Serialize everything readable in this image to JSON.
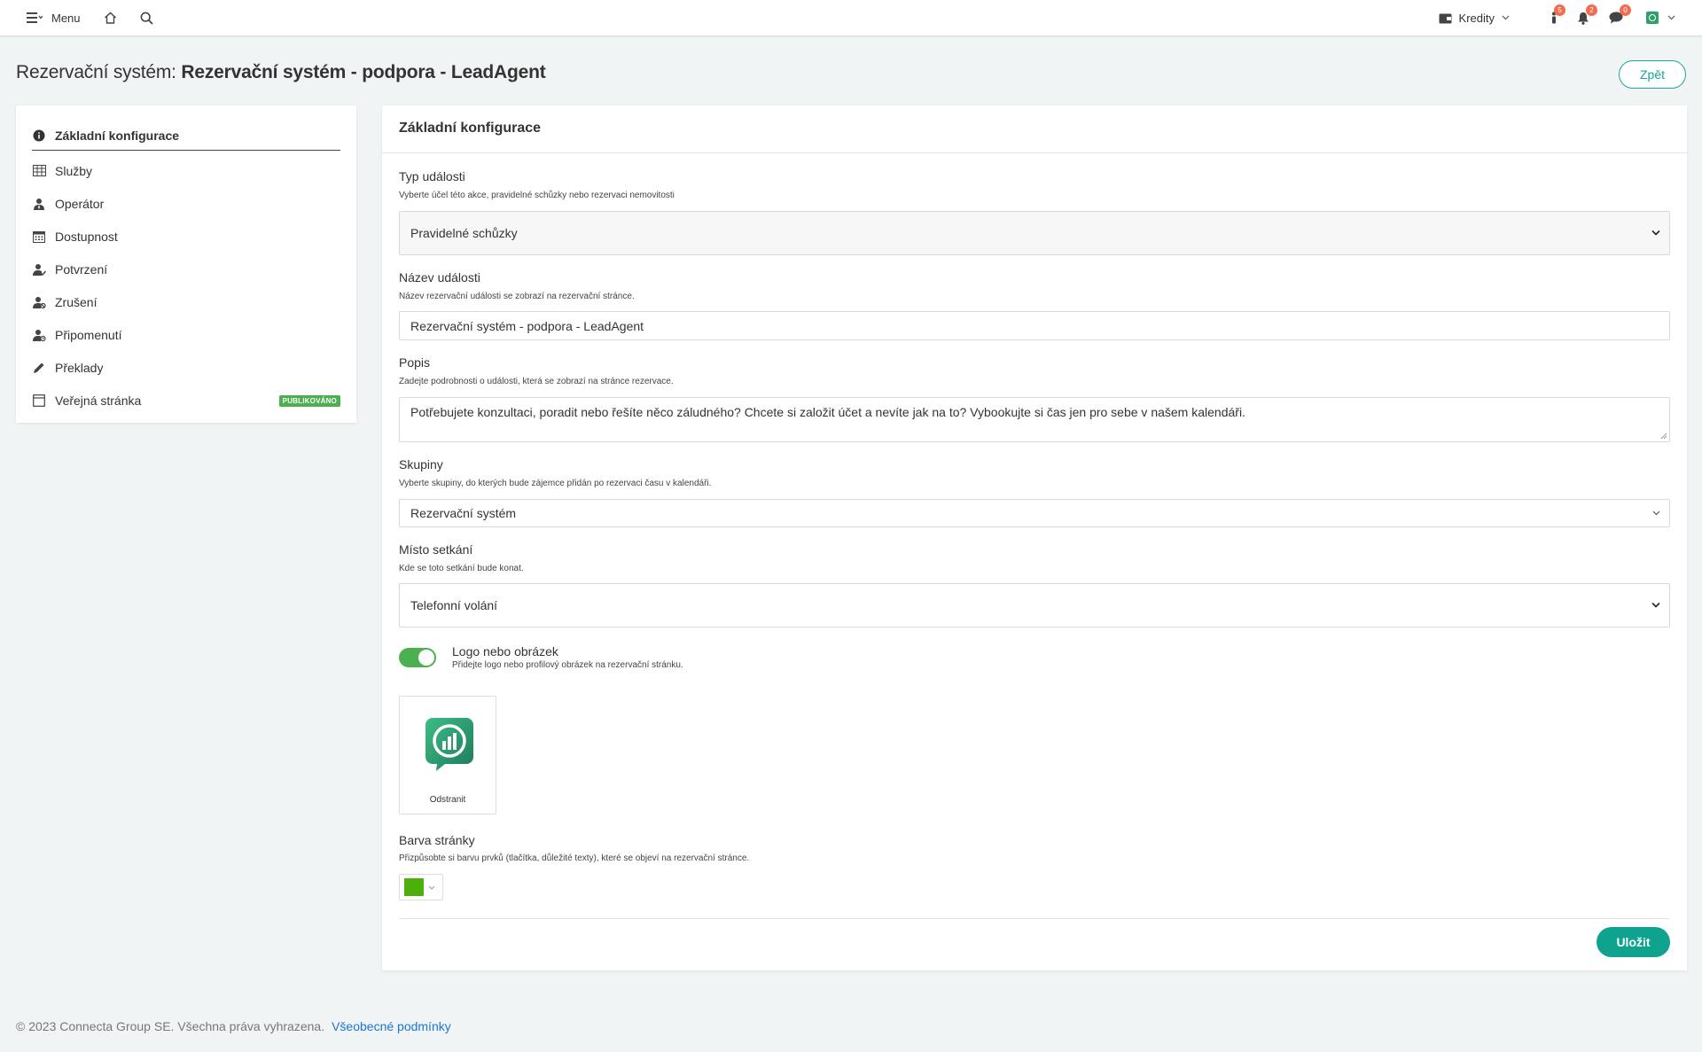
{
  "topbar": {
    "menu_label": "Menu",
    "credits_label": "Kredity",
    "badges": {
      "info": "5",
      "bell": "2",
      "chat": "0"
    },
    "brand_color": "#2e9e6b",
    "badge_color": "#f26c4f"
  },
  "header": {
    "prefix": "Rezervační systém: ",
    "title": "Rezervační systém - podpora - LeadAgent",
    "back_label": "Zpět"
  },
  "sidebar": {
    "items": [
      {
        "label": "Základní konfigurace",
        "icon": "info-circle-icon"
      },
      {
        "label": "Služby",
        "icon": "table-icon"
      },
      {
        "label": "Operátor",
        "icon": "user-tie-icon"
      },
      {
        "label": "Dostupnost",
        "icon": "calendar-icon"
      },
      {
        "label": "Potvrzení",
        "icon": "user-check-icon"
      },
      {
        "label": "Zrušení",
        "icon": "user-cancel-icon"
      },
      {
        "label": "Připomenutí",
        "icon": "user-clock-icon"
      },
      {
        "label": "Překlady",
        "icon": "pencil-icon"
      },
      {
        "label": "Veřejná stránka",
        "icon": "window-icon",
        "badge": "PUBLIKOVÁNO"
      }
    ]
  },
  "panel": {
    "title": "Základní konfigurace",
    "event_type": {
      "label": "Typ události",
      "help": "Vyberte účel této akce, pravidelné schůzky nebo rezervaci nemovitosti",
      "value": "Pravidelné schůzky"
    },
    "event_name": {
      "label": "Název události",
      "help": "Název rezervační události se zobrazí na rezervační stránce.",
      "value": "Rezervační systém - podpora - LeadAgent"
    },
    "description": {
      "label": "Popis",
      "help": "Zadejte podrobnosti o události, která se zobrazí na stránce rezervace.",
      "value": "Potřebujete konzultaci, poradit nebo řešíte něco záludného? Chcete si založit účet a nevíte jak na to? Vybookujte si čas jen pro sebe v našem kalendáři."
    },
    "groups": {
      "label": "Skupiny",
      "help": "Vyberte skupiny, do kterých bude zájemce přidán po rezervaci času v kalendáři.",
      "value": "Rezervační systém"
    },
    "location": {
      "label": "Místo setkání",
      "help": "Kde se toto setkání bude konat.",
      "value": "Telefonní volání"
    },
    "logo": {
      "label": "Logo nebo obrázek",
      "help": "Přidejte logo nebo profilový obrázek na rezervační stránku.",
      "enabled": true,
      "remove_label": "Odstranit"
    },
    "page_color": {
      "label": "Barva stránky",
      "help": "Přizpůsobte si barvu prvků (tlačítka, důležité texty), které se objeví na rezervační stránce.",
      "value": "#4caf0a"
    },
    "save_label": "Uložit"
  },
  "footer": {
    "copyright": "© 2023 Connecta Group SE. Všechna práva vyhrazena.",
    "terms_link": "Všeobecné podmínky"
  }
}
